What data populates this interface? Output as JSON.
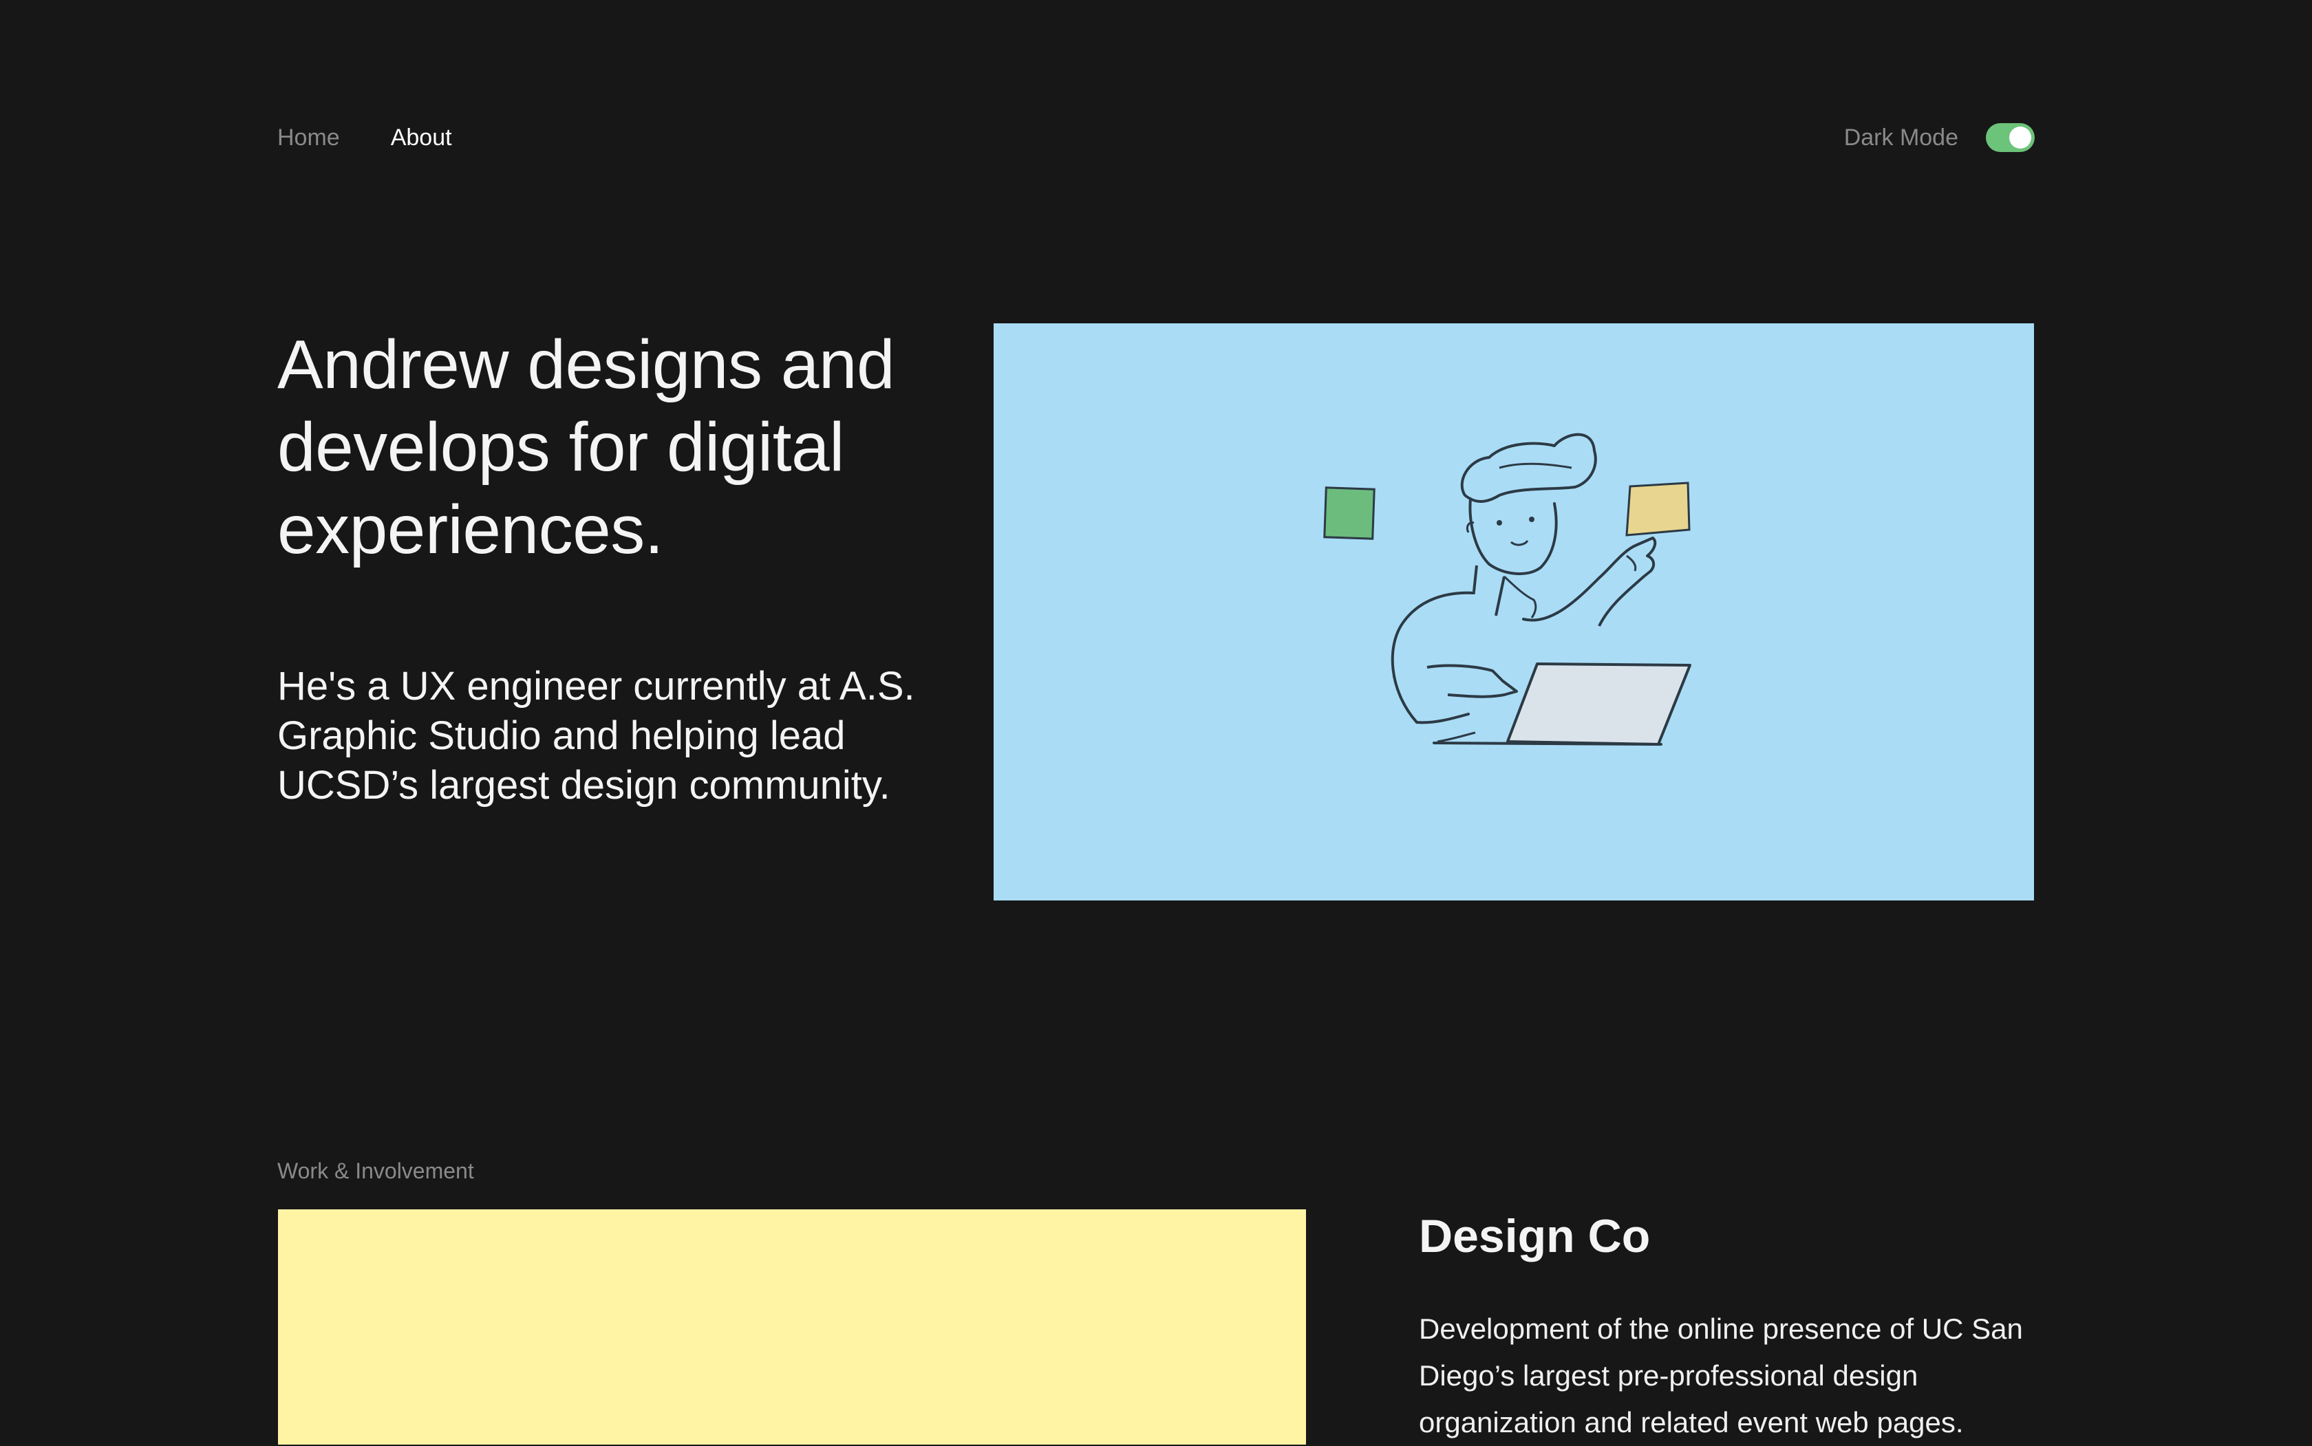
{
  "nav": {
    "links": [
      {
        "label": "Home",
        "active": false
      },
      {
        "label": "About",
        "active": true
      }
    ],
    "dark_mode_label": "Dark Mode",
    "dark_mode_on": true
  },
  "hero": {
    "title": "Andrew designs and develops for digital experiences.",
    "subtitle": "He's a UX engineer currently at A.S. Graphic Studio and helping lead UCSD’s largest design community.",
    "illustration_bg": "#aadcf5"
  },
  "work": {
    "section_label": "Work & Involvement",
    "item": {
      "title": "Design Co",
      "description": "Development of the online presence of UC San Diego’s largest pre-professional design organization and related event web pages.",
      "image_bg": "#fff4a4"
    }
  },
  "colors": {
    "background": "#171717",
    "toggle_on": "#6cc37a",
    "muted_text": "#8a8a8a"
  }
}
